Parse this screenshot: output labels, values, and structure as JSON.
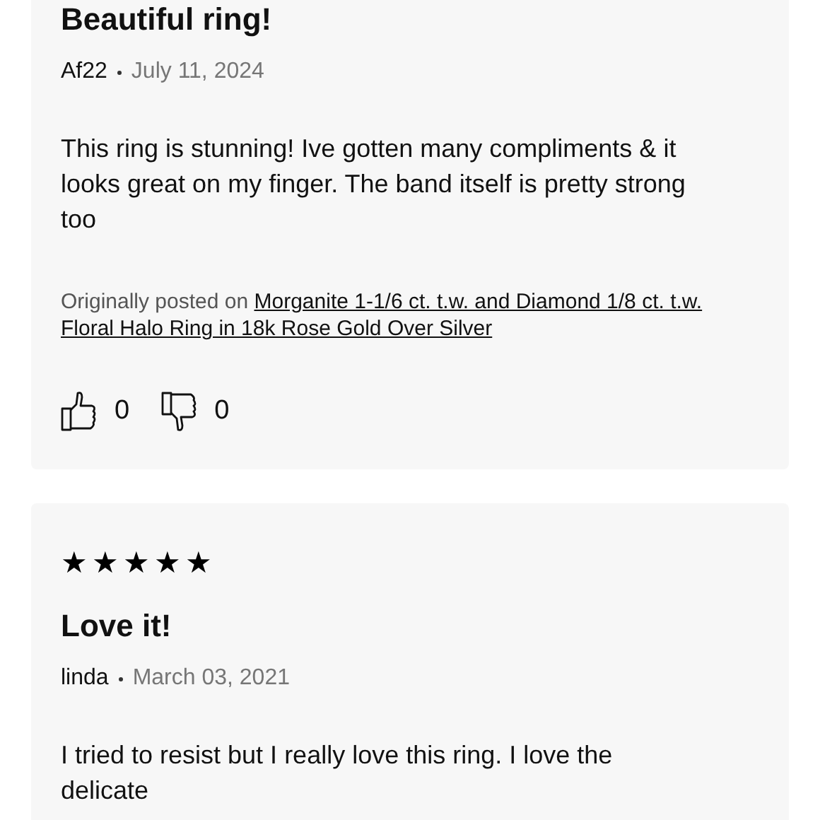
{
  "reviews": [
    {
      "title": "Beautiful ring!",
      "author": "Af22",
      "date": "July 11, 2024",
      "body": "This ring is stunning! Ive gotten many compliments & it looks great on my finger. The band itself is pretty strong too",
      "source_prefix": "Originally posted on",
      "source_link": "Morganite 1-1/6 ct. t.w. and Diamond 1/8 ct. t.w. Floral Halo Ring in 18k Rose Gold Over Silver",
      "helpful_count": "0",
      "unhelpful_count": "0"
    },
    {
      "stars": 5,
      "title": "Love it!",
      "author": "linda",
      "date": "March 03, 2021",
      "body": "I tried to resist but I really love this ring. I love the delicate"
    }
  ]
}
